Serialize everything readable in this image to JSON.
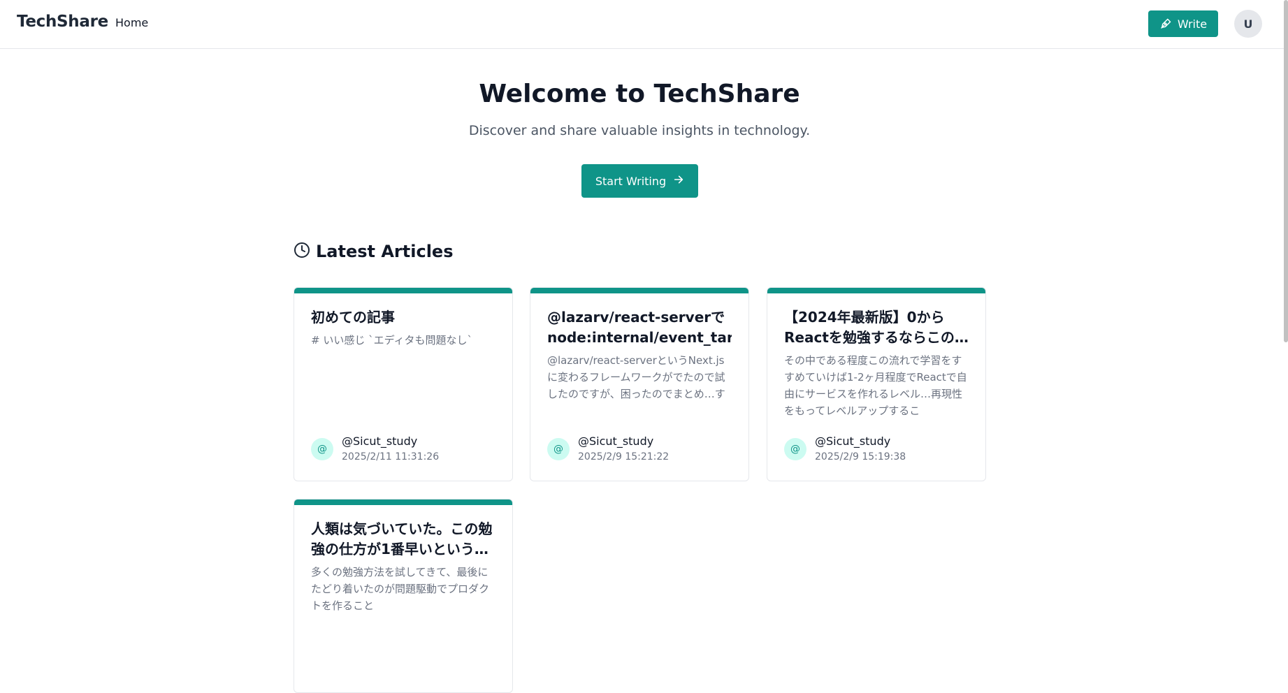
{
  "header": {
    "brand": "TechShare",
    "nav": {
      "home": "Home"
    },
    "write_label": "Write",
    "avatar_initial": "U"
  },
  "hero": {
    "title": "Welcome to TechShare",
    "subtitle": "Discover and share valuable insights in technology.",
    "cta_label": "Start Writing"
  },
  "latest": {
    "heading": "Latest Articles",
    "articles": [
      {
        "title": "初めての記事",
        "excerpt": "# いい感じ `エディタも問題なし`",
        "author_initial": "@",
        "author": "@Sicut_study",
        "date": "2025/2/11 11:31:26"
      },
      {
        "title": "@lazarv/react-serverで node:internal/event_target…",
        "excerpt": "@lazarv/react-serverというNext.jsに変わるフレームワークがでたので試したのですが、困ったのでまとめ…す",
        "author_initial": "@",
        "author": "@Sicut_study",
        "date": "2025/2/9 15:21:22"
      },
      {
        "title": "【2024年最新版】0からReactを勉強するならこの…",
        "excerpt": "その中である程度この流れで学習をすすめていけば1-2ヶ月程度でReactで自由にサービスを作れるレベル…再現性をもってレベルアップするこ",
        "author_initial": "@",
        "author": "@Sicut_study",
        "date": "2025/2/9 15:19:38"
      },
      {
        "title": "人類は気づいていた。この勉強の仕方が1番早いという…",
        "excerpt": "多くの勉強方法を試してきて、最後にたどり着いたのが問題駆動でプロダクトを作ること",
        "author_initial": "@",
        "author": "",
        "date": ""
      }
    ]
  },
  "colors": {
    "accent": "#0f9488",
    "accent_soft": "#ccfbf1",
    "text": "#111827",
    "muted": "#6b7280"
  },
  "icons": {
    "write": "pen-tool-icon",
    "start": "arrow-right-icon",
    "latest": "clock-icon"
  }
}
